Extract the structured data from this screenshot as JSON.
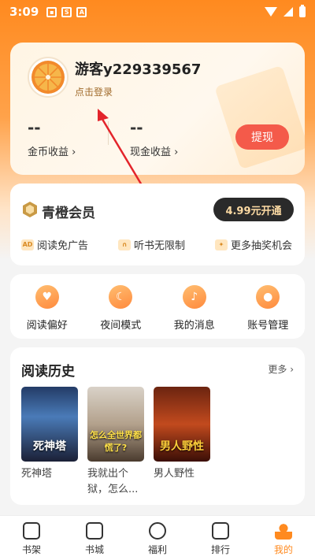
{
  "status_bar": {
    "time": "3:09",
    "icons": [
      "image-icon",
      "s-app-icon",
      "a-app-icon"
    ]
  },
  "profile": {
    "username": "游客y229339567",
    "login_hint": "点击登录",
    "coins_value": "--",
    "coins_label": "金币收益",
    "cash_value": "--",
    "cash_label": "现金收益",
    "withdraw_label": "提现"
  },
  "vip": {
    "title": "青橙会员",
    "button": "4.99元开通",
    "perks": [
      {
        "icon": "AD",
        "label": "阅读免广告"
      },
      {
        "icon": "headphones-icon",
        "label": "听书无限制"
      },
      {
        "icon": "gift-icon",
        "label": "更多抽奖机会"
      }
    ]
  },
  "actions": [
    {
      "icon": "heart-icon",
      "label": "阅读偏好"
    },
    {
      "icon": "moon-icon",
      "label": "夜间模式"
    },
    {
      "icon": "bell-icon",
      "label": "我的消息"
    },
    {
      "icon": "user-icon",
      "label": "账号管理"
    }
  ],
  "history": {
    "title": "阅读历史",
    "more": "更多",
    "books": [
      {
        "cover_text": "死神塔",
        "title": "死神塔"
      },
      {
        "cover_text": "怎么全世界都慌了?",
        "title": "我就出个狱，怎么..."
      },
      {
        "cover_text": "男人野性",
        "title": "男人野性"
      }
    ]
  },
  "nav": [
    {
      "icon": "bookshelf-icon",
      "label": "书架"
    },
    {
      "icon": "bookstore-icon",
      "label": "书城"
    },
    {
      "icon": "gift-diamond-icon",
      "label": "福利"
    },
    {
      "icon": "ranking-icon",
      "label": "排行"
    },
    {
      "icon": "profile-icon",
      "label": "我的"
    }
  ],
  "colors": {
    "brand_orange": "#ff8a1f",
    "withdraw_red": "#f45a4a",
    "vip_dark": "#2a2a2a"
  }
}
